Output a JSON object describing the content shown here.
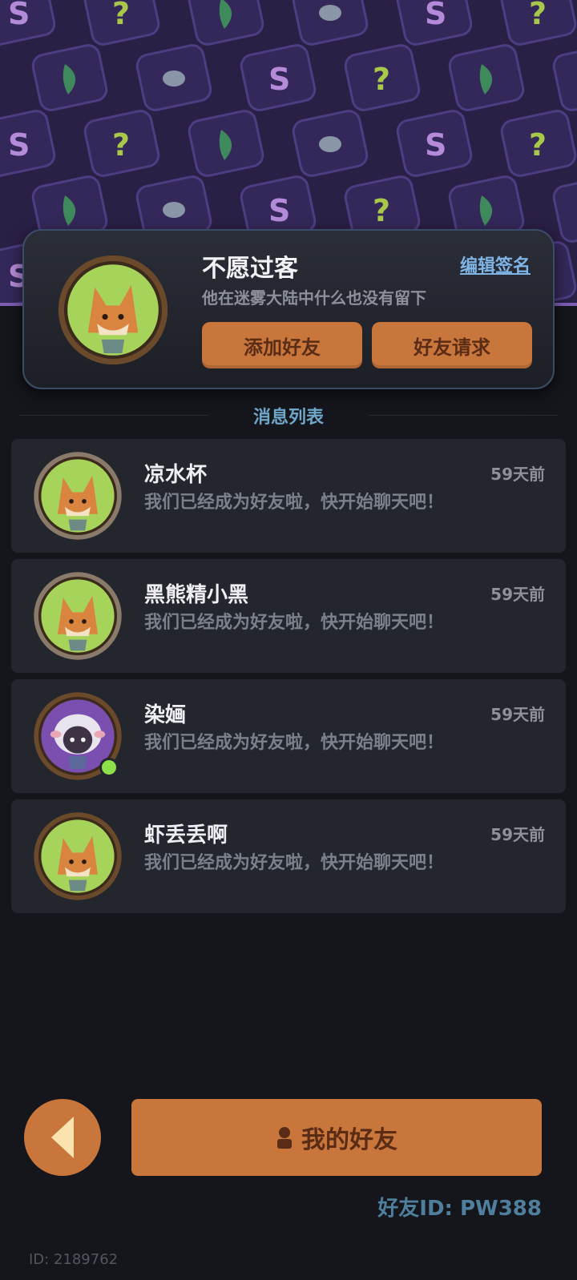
{
  "profile": {
    "name": "不愿过客",
    "signature": "他在迷雾大陆中什么也没有留下",
    "edit_label": "编辑签名",
    "add_friend_label": "添加好友",
    "friend_request_label": "好友请求"
  },
  "section": {
    "title": "消息列表"
  },
  "messages": [
    {
      "name": "凉水杯",
      "time": "59天前",
      "text": "我们已经成为好友啦，快开始聊天吧！",
      "avatar": "fox-avatar-icon",
      "online": false
    },
    {
      "name": "黑熊精小黑",
      "time": "59天前",
      "text": "我们已经成为好友啦，快开始聊天吧！",
      "avatar": "fox-avatar-icon",
      "online": false
    },
    {
      "name": "染婳",
      "time": "59天前",
      "text": "我们已经成为好友啦，快开始聊天吧！",
      "avatar": "sheep-avatar-icon",
      "online": true
    },
    {
      "name": "虾丢丢啊",
      "time": "59天前",
      "text": "我们已经成为好友啦，快开始聊天吧！",
      "avatar": "fox-avatar-icon",
      "online": false
    }
  ],
  "footer": {
    "my_friends_label": "我的好友",
    "friend_id": "好友ID: PW388",
    "user_id": "ID: 2189762"
  },
  "colors": {
    "accent_orange": "#c8763c",
    "banner_purple": "#2a1f45",
    "online_green": "#8ee04a",
    "section_blue": "#6fa6c9"
  }
}
